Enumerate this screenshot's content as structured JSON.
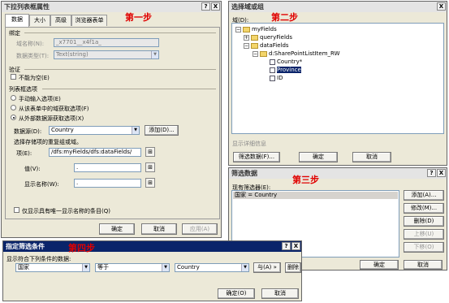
{
  "ann": {
    "s1": "第一步",
    "s2": "第二步",
    "s3": "第三步",
    "s4": "第四步"
  },
  "props": {
    "title": "下拉列表框属性",
    "tbtn_help": "?",
    "tbtn_close": "X",
    "tabs": [
      "数据",
      "大小",
      "高级",
      "浏览器表单"
    ],
    "binding_group": "绑定",
    "field_name_label": "域名称(N):",
    "field_name_value": "_x7701__x4f1a_",
    "data_type_label": "数据类型(T):",
    "data_type_value": "Text(string)",
    "validation_group": "验证",
    "not_empty": "不能为空(E)",
    "list_options_group": "列表框选项",
    "opt_manual": "手动输入选项(E)",
    "opt_form": "从该表单中的域获取选项(F)",
    "opt_external": "从外部数据源获取选项(X)",
    "datasource_label": "数据源(D):",
    "datasource_value": "Country",
    "add_button": "添加(D)...",
    "entries_hint": "选择存储项的重复组或域。",
    "entries_label": "项(E):",
    "entries_value": "/dfs:myFields/dfs:dataFields/",
    "value_label": "值(V):",
    "value_value": ".",
    "display_label": "显示名称(W):",
    "display_value": ".",
    "unique_only": "仅显示具有唯一显示名称的条目(Q)",
    "ok": "确定",
    "cancel": "取消",
    "apply": "应用(A)"
  },
  "select_field": {
    "title": "选择域或组",
    "tbtn_close": "X",
    "field_label": "域(D):",
    "tree": [
      "myFields",
      "queryFields",
      "dataFields",
      "d:SharePointListItem_RW",
      "Country*",
      "Province",
      "ID"
    ],
    "show_details": "显示详细信息",
    "filter_button": "筛选数据(F)...",
    "ok": "确定",
    "cancel": "取消"
  },
  "filter_data": {
    "title": "筛选数据",
    "tbtn_help": "?",
    "tbtn_close": "X",
    "existing_label": "现有筛选器(E):",
    "filters": [
      "国家 = Country"
    ],
    "add": "添加(A)...",
    "modify": "修改(M)...",
    "delete": "删除(D)",
    "move_up": "上移(U)",
    "move_down": "下移(O)",
    "ok": "确定",
    "cancel": "取消"
  },
  "spec_filter": {
    "title": "指定筛选条件",
    "tbtn_help": "?",
    "tbtn_close": "X",
    "desc": "显示符合下列条件的数据:",
    "field": "国家",
    "operator": "等于",
    "value": "Country",
    "and_button": "与(A) »",
    "delete": "删除",
    "ok": "确定(O)",
    "cancel": "取消"
  }
}
